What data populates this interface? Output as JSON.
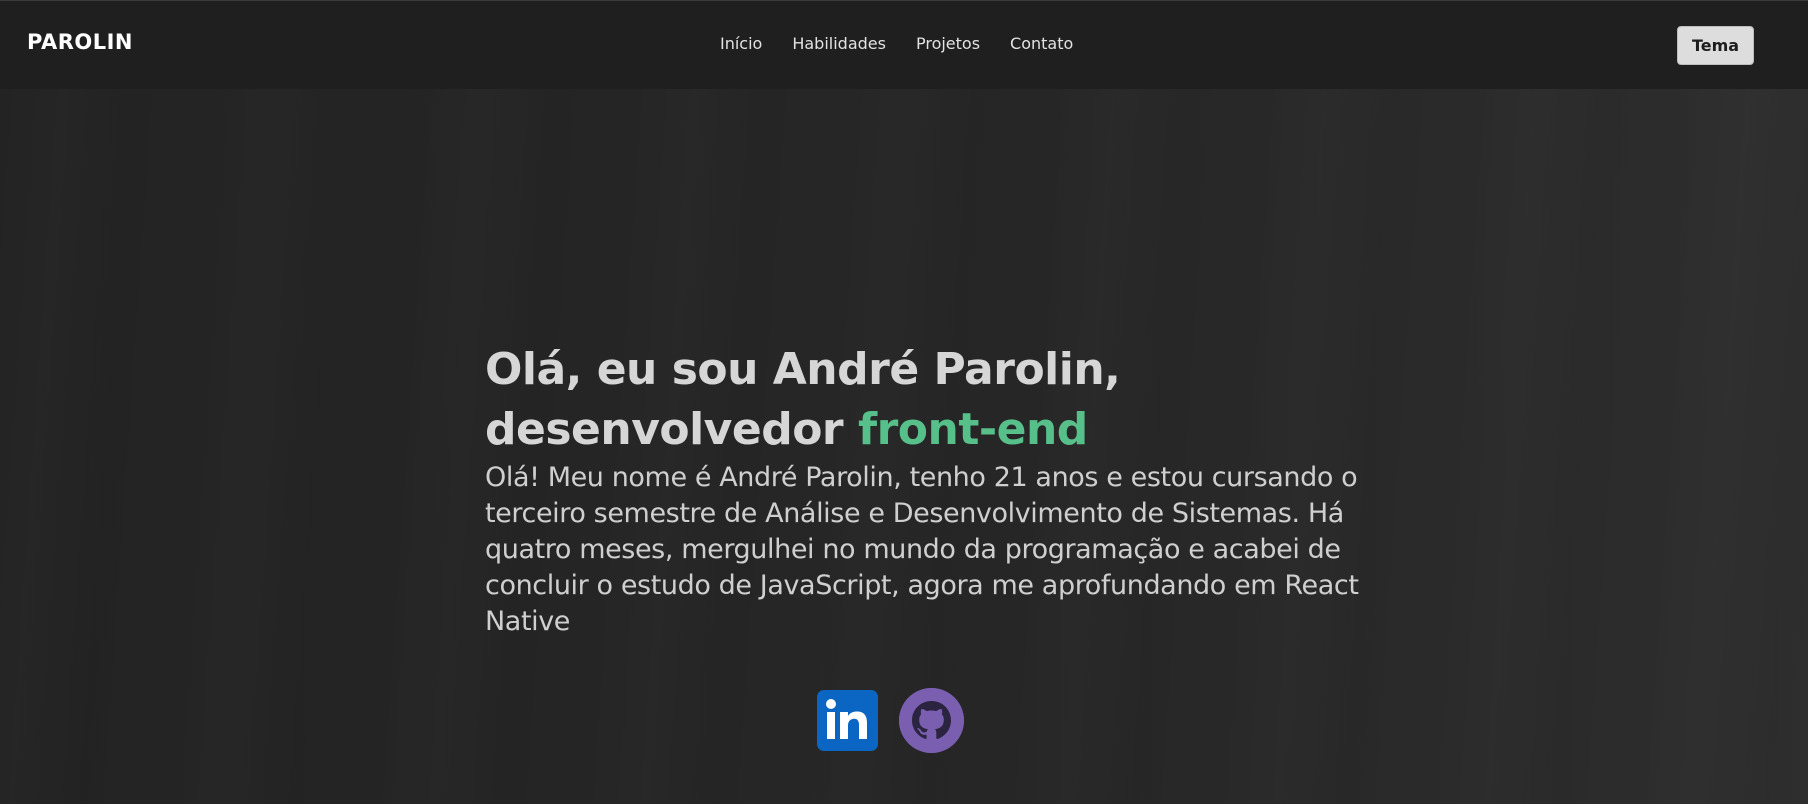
{
  "header": {
    "brand": "PAROLIN",
    "nav": [
      {
        "label": "Início"
      },
      {
        "label": "Habilidades"
      },
      {
        "label": "Projetos"
      },
      {
        "label": "Contato"
      }
    ],
    "theme_button": "Tema"
  },
  "hero": {
    "title_line1": "Olá, eu sou André Parolin,",
    "title_line2_prefix": "desenvolvedor ",
    "title_line2_accent": "front-end",
    "description": "Olá! Meu nome é André Parolin, tenho 21 anos e estou cursando o terceiro semestre de Análise e Desenvolvimento de Sistemas. Há quatro meses, mergulhei no mundo da programação e acabei de concluir o estudo de JavaScript, agora me aprofundando em React Native"
  },
  "socials": [
    {
      "icon": "linkedin-icon"
    },
    {
      "icon": "github-icon"
    }
  ],
  "colors": {
    "accent": "#57c08a",
    "header_bg": "#1f1f1f",
    "page_bg": "#262626",
    "linkedin": "#0a66c2",
    "github": "#7a5fb0"
  }
}
